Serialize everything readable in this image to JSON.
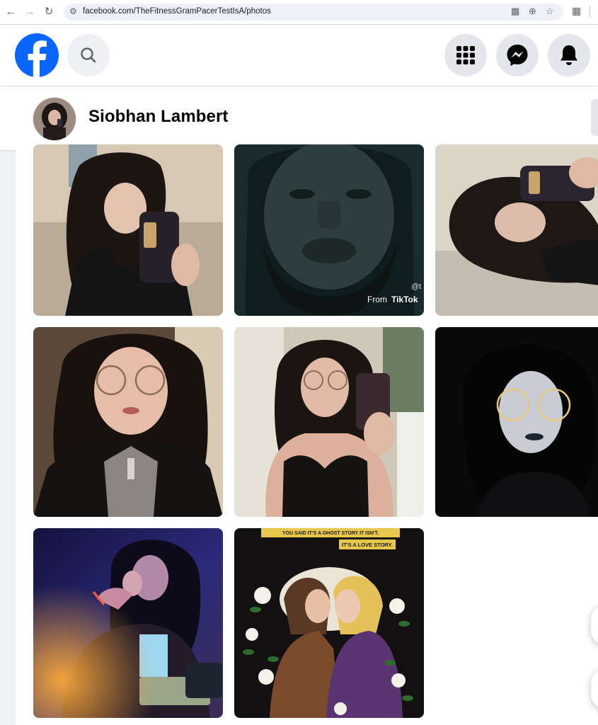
{
  "browser": {
    "url": "facebook.com/TheFitnessGramPacerTestIsA/photos",
    "back_icon": "arrow-left-icon",
    "forward_icon": "arrow-right-icon",
    "reload_icon": "reload-icon"
  },
  "header": {
    "logo": "facebook-logo",
    "search_icon": "search-icon",
    "menu_icon": "apps-grid-icon",
    "messenger_icon": "messenger-icon",
    "notifications_icon": "bell-icon",
    "brand_color": "#0866ff"
  },
  "profile": {
    "name": "Siobhan Lambert"
  },
  "photos": [
    {
      "id": "p1",
      "subject": "curly-haired woman mirror selfie with phone"
    },
    {
      "id": "p2",
      "subject": "close-up bearded face",
      "overlay": "From",
      "overlay_brand": "TikTok",
      "handle": "@t"
    },
    {
      "id": "p3",
      "subject": "rotated mirror selfie with phone"
    },
    {
      "id": "p4",
      "subject": "woman with round glasses and cross necklace"
    },
    {
      "id": "p5",
      "subject": "woman mirror selfie in black lace top"
    },
    {
      "id": "p6",
      "subject": "dark portrait with glasses and black lipstick"
    },
    {
      "id": "p7",
      "subject": "blue-lit photo, person drinking with glow bracelet"
    },
    {
      "id": "p8",
      "subject": "comic illustration of two women kissing with flowers",
      "caption1": "YOU SAID IT'S A GHOST STORY IT ISN'T.",
      "caption2": "IT'S A LOVE STORY."
    }
  ]
}
